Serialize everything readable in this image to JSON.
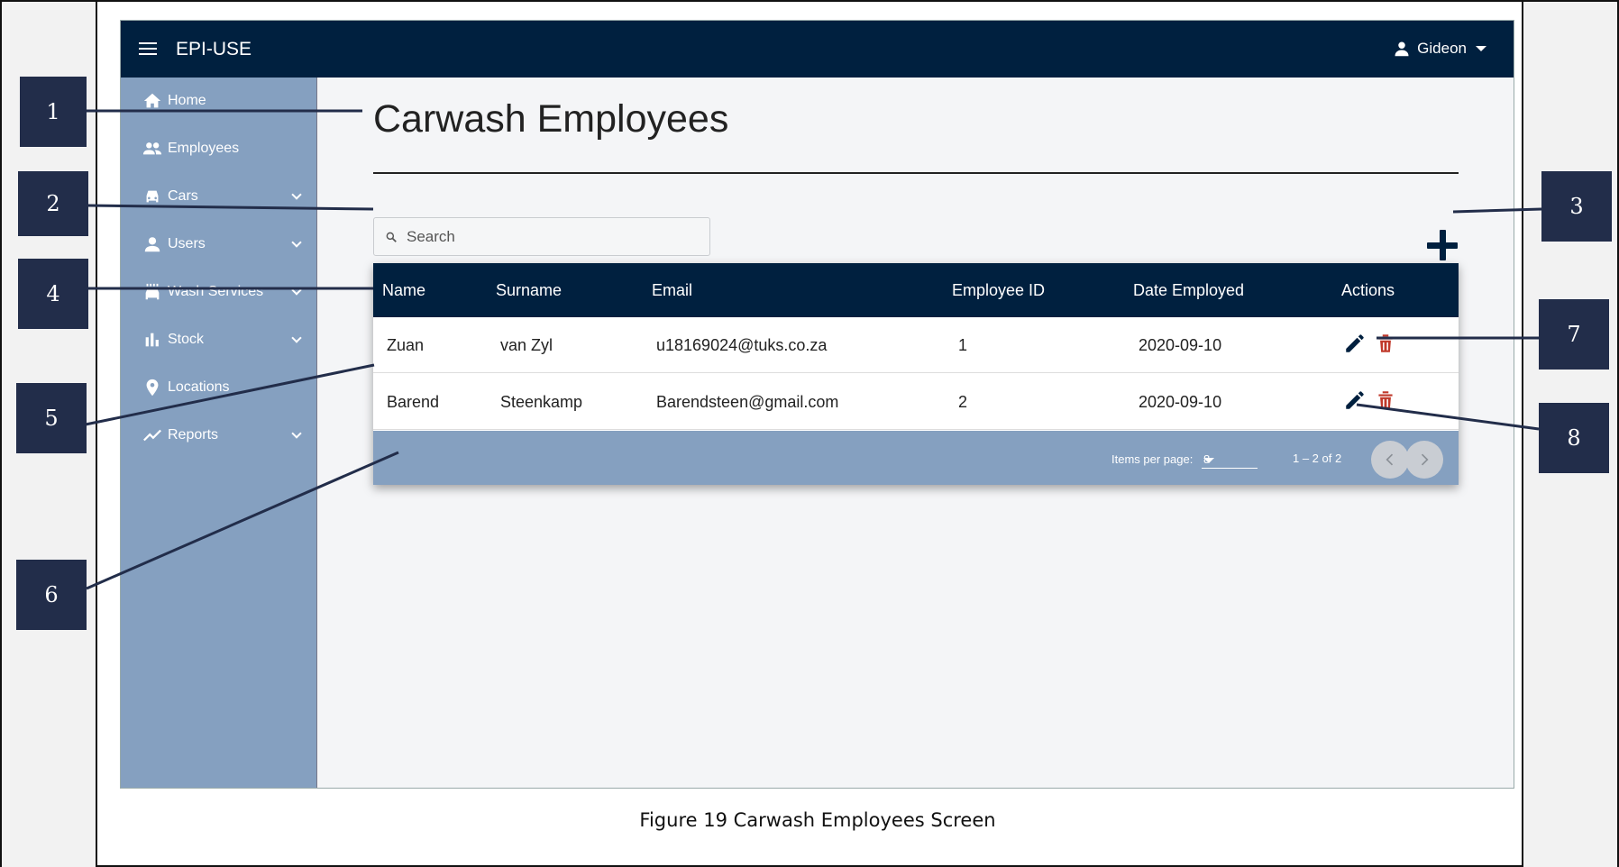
{
  "app": {
    "brand": "EPI-USE",
    "user_name": "Gideon"
  },
  "sidebar": {
    "items": [
      {
        "label": "Home",
        "icon": "home-icon",
        "has_submenu": false
      },
      {
        "label": "Employees",
        "icon": "people-icon",
        "has_submenu": false
      },
      {
        "label": "Cars",
        "icon": "car-icon",
        "has_submenu": true
      },
      {
        "label": "Users",
        "icon": "person-icon",
        "has_submenu": true
      },
      {
        "label": "Wash Services",
        "icon": "car-wash-icon",
        "has_submenu": true
      },
      {
        "label": "Stock",
        "icon": "bar-chart-icon",
        "has_submenu": true
      },
      {
        "label": "Locations",
        "icon": "location-pin-icon",
        "has_submenu": false
      },
      {
        "label": "Reports",
        "icon": "trend-line-icon",
        "has_submenu": true
      }
    ]
  },
  "main": {
    "title": "Carwash Employees",
    "search_placeholder": "Search",
    "add_button_icon": "plus-icon"
  },
  "table": {
    "columns": [
      "Name",
      "Surname",
      "Email",
      "Employee ID",
      "Date Employed",
      "Actions"
    ],
    "rows": [
      {
        "name": "Zuan",
        "surname": "van Zyl",
        "email": "u18169024@tuks.co.za",
        "employee_id": "1",
        "date_employed": "2020-09-10"
      },
      {
        "name": "Barend",
        "surname": "Steenkamp",
        "email": "Barendsteen@gmail.com",
        "employee_id": "2",
        "date_employed": "2020-09-10"
      }
    ],
    "paginator": {
      "items_per_page_label": "Items per page:",
      "items_per_page_value": "8",
      "range_label": "1 – 2 of 2"
    }
  },
  "callouts": [
    "1",
    "2",
    "3",
    "4",
    "5",
    "6",
    "7",
    "8"
  ],
  "caption": "Figure 19 Carwash Employees Screen",
  "colors": {
    "topbar": "#00203f",
    "sidebar": "#85a0c0",
    "delete": "#c0392b",
    "callout": "#222d4a"
  }
}
